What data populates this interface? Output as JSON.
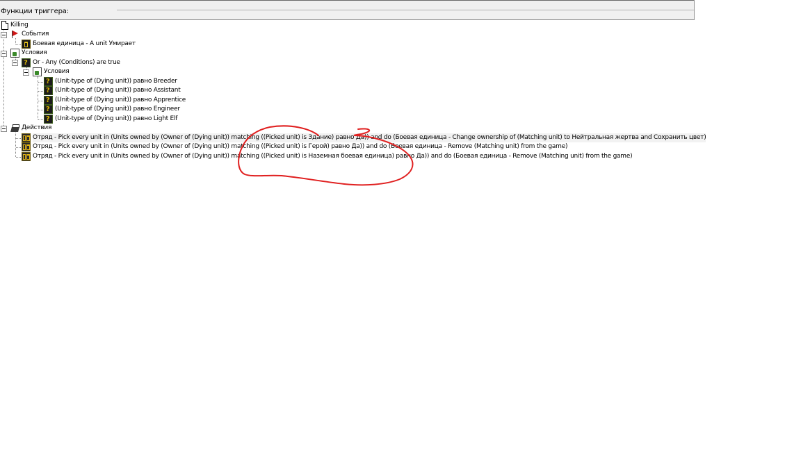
{
  "header": {
    "title": "Функции триггера:"
  },
  "tree": {
    "root_label": "Killing",
    "events": {
      "label": "События",
      "items": [
        "Боевая единица - A unit Умирает"
      ]
    },
    "conditions": {
      "label": "Условия",
      "or_label": "Or - Any (Conditions) are true",
      "sub_label": "Условия",
      "items": [
        "(Unit-type of (Dying unit)) равно Breeder",
        "(Unit-type of (Dying unit)) равно Assistant",
        "(Unit-type of (Dying unit)) равно Apprentice",
        "(Unit-type of (Dying unit)) равно Engineer",
        "(Unit-type of (Dying unit)) равно Light Elf"
      ]
    },
    "actions": {
      "label": "Действия",
      "items": [
        "Отряд - Pick every unit in (Units owned by (Owner of (Dying unit)) matching ((Picked unit) is Здание) равно Да)) and do (Боевая единица - Change ownership of (Matching unit) to Нейтральная жертва and Сохранить цвет)",
        "Отряд - Pick every unit in (Units owned by (Owner of (Dying unit)) matching ((Picked unit) is Герой) равно Да)) and do (Боевая единица - Remove (Matching unit) from the game)",
        "Отряд - Pick every unit in (Units owned by (Owner of (Dying unit)) matching ((Picked unit) is Наземная боевая единица) равно Да)) and do (Боевая единица - Remove (Matching unit) from the game)"
      ]
    }
  },
  "annotation_color": "#e02020"
}
